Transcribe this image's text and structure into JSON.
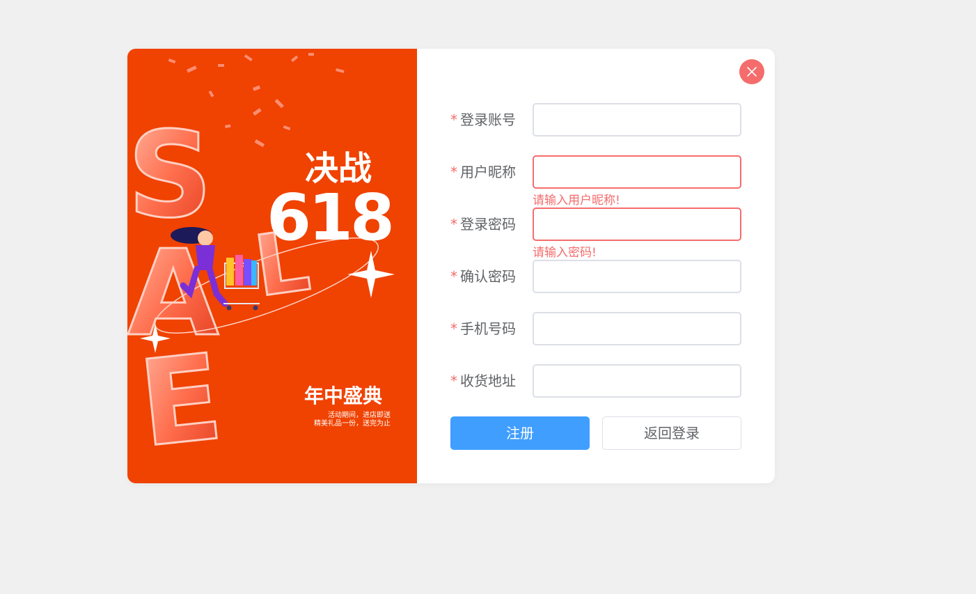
{
  "banner": {
    "headline_line1": "决战",
    "headline_line2": "618",
    "balloon_letters": [
      "S",
      "A",
      "L",
      "E"
    ],
    "sub_title": "年中盛典",
    "promo_line1": "活动期间，进店即送",
    "promo_line2": "精美礼品一份，送完为止"
  },
  "form": {
    "required_mark": "*",
    "fields": [
      {
        "label": "登录账号",
        "value": "",
        "error": ""
      },
      {
        "label": "用户昵称",
        "value": "",
        "error": "请输入用户昵称!"
      },
      {
        "label": "登录密码",
        "value": "",
        "error": "请输入密码!"
      },
      {
        "label": "确认密码",
        "value": "",
        "error": ""
      },
      {
        "label": "手机号码",
        "value": "",
        "error": ""
      },
      {
        "label": "收货地址",
        "value": "",
        "error": ""
      }
    ],
    "register_label": "注册",
    "back_label": "返回登录"
  },
  "colors": {
    "banner_bg": "#f04200",
    "primary": "#409eff",
    "danger": "#f56c6c",
    "page_bg": "#f0f0f0"
  }
}
